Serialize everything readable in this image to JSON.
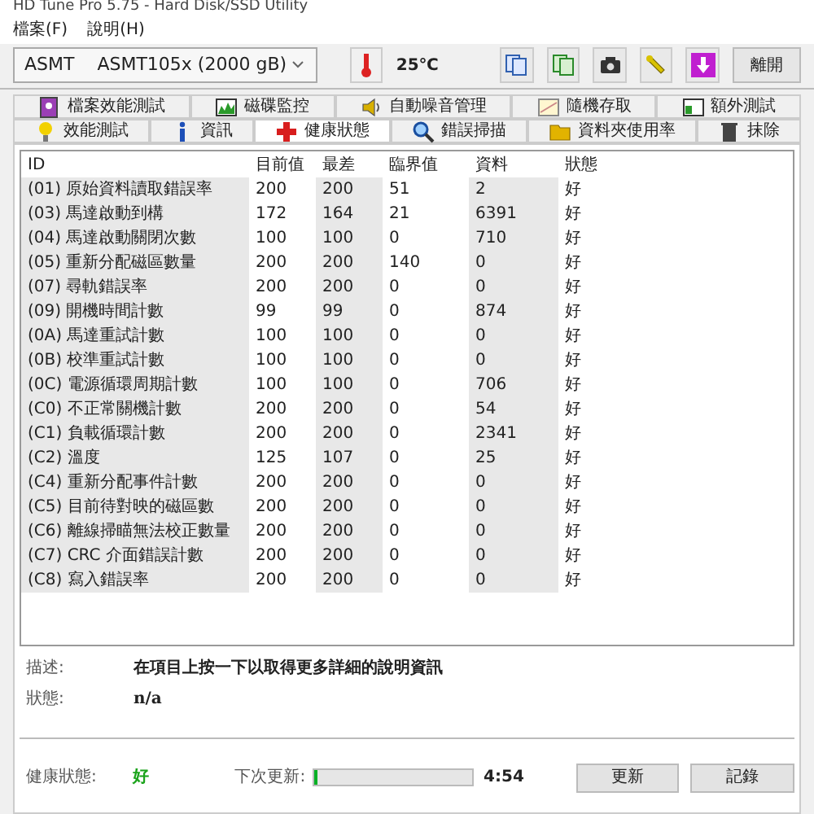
{
  "window": {
    "title": "HD Tune Pro 5.75 - Hard Disk/SSD Utility"
  },
  "menu": [
    "檔案(F)",
    "說明(H)"
  ],
  "toolbar": {
    "drive": "ASMT    ASMT105x (2000 gB)",
    "temperature": "25℃",
    "buttons": [
      {
        "kind": "copy"
      },
      {
        "kind": "copy-all"
      },
      {
        "kind": "camera"
      },
      {
        "kind": "options"
      },
      {
        "kind": "save"
      }
    ],
    "exit": "離開"
  },
  "tabs_back": [
    {
      "label": "檔案效能測試",
      "selected": false
    },
    {
      "label": "磁碟監控",
      "selected": false
    },
    {
      "label": "自動噪音管理",
      "selected": false
    },
    {
      "label": "隨機存取",
      "selected": false
    },
    {
      "label": "額外測試",
      "selected": false
    }
  ],
  "tabs_front": [
    {
      "label": "效能測試",
      "selected": false
    },
    {
      "label": "資訊",
      "selected": false
    },
    {
      "label": "健康狀態",
      "selected": true
    },
    {
      "label": "錯誤掃描",
      "selected": false
    },
    {
      "label": "資料夾使用率",
      "selected": false
    },
    {
      "label": "抹除",
      "selected": false
    }
  ],
  "table": {
    "columns": [
      "ID",
      "目前值",
      "最差",
      "臨界值",
      "資料",
      "狀態"
    ],
    "rows": [
      [
        "(01) 原始資料讀取錯誤率",
        "200",
        "200",
        "51",
        "2",
        "好"
      ],
      [
        "(03) 馬達啟動到構",
        "172",
        "164",
        "21",
        "6391",
        "好"
      ],
      [
        "(04) 馬達啟動關閉次數",
        "100",
        "100",
        "0",
        "710",
        "好"
      ],
      [
        "(05) 重新分配磁區數量",
        "200",
        "200",
        "140",
        "0",
        "好"
      ],
      [
        "(07) 尋軌錯誤率",
        "200",
        "200",
        "0",
        "0",
        "好"
      ],
      [
        "(09) 開機時間計數",
        "99",
        "99",
        "0",
        "874",
        "好"
      ],
      [
        "(0A) 馬達重試計數",
        "100",
        "100",
        "0",
        "0",
        "好"
      ],
      [
        "(0B) 校準重試計數",
        "100",
        "100",
        "0",
        "0",
        "好"
      ],
      [
        "(0C) 電源循環周期計數",
        "100",
        "100",
        "0",
        "706",
        "好"
      ],
      [
        "(C0) 不正常關機計數",
        "200",
        "200",
        "0",
        "54",
        "好"
      ],
      [
        "(C1) 負載循環計數",
        "200",
        "200",
        "0",
        "2341",
        "好"
      ],
      [
        "(C2) 溫度",
        "125",
        "107",
        "0",
        "25",
        "好"
      ],
      [
        "(C4) 重新分配事件計數",
        "200",
        "200",
        "0",
        "0",
        "好"
      ],
      [
        "(C5) 目前待對映的磁區數",
        "200",
        "200",
        "0",
        "0",
        "好"
      ],
      [
        "(C6) 離線掃瞄無法校正數量",
        "200",
        "200",
        "0",
        "0",
        "好"
      ],
      [
        "(C7) CRC 介面錯誤計數",
        "200",
        "200",
        "0",
        "0",
        "好"
      ],
      [
        "(C8) 寫入錯誤率",
        "200",
        "200",
        "0",
        "0",
        "好"
      ]
    ]
  },
  "description": {
    "label": "描述:",
    "value": "在項目上按一下以取得更多詳細的說明資訊"
  },
  "status": {
    "label": "狀態:",
    "value": "n/a"
  },
  "footer": {
    "health_label": "健康狀態:",
    "health": "好",
    "next_label": "下次更新:",
    "level": 0.02,
    "time": "4:54",
    "buttons": [
      "更新",
      "記錄"
    ]
  }
}
